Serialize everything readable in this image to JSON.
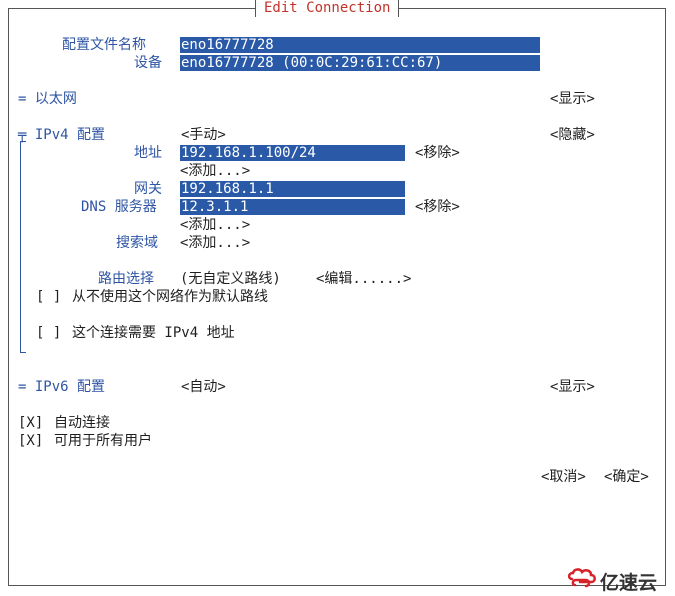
{
  "window": {
    "title": "Edit Connection"
  },
  "profile": {
    "name_label": "配置文件名称",
    "name_value": "eno16777728",
    "device_label": "设备",
    "device_value": "eno16777728 (00:0C:29:61:CC:67)"
  },
  "ethernet": {
    "label": "= 以太网",
    "toggle": "<显示>"
  },
  "ipv4": {
    "label": "╤ IPv4 配置",
    "method": "<手动>",
    "toggle": "<隐藏>",
    "address_label": "地址",
    "address_value": "192.168.1.100/24",
    "address_remove": "<移除>",
    "address_add": "<添加...>",
    "gateway_label": "网关",
    "gateway_value": "192.168.1.1",
    "dns_label": "DNS 服务器",
    "dns_value": "12.3.1.1",
    "dns_remove": "<移除>",
    "dns_add": "<添加...>",
    "search_label": "搜索域",
    "search_add": "<添加...>",
    "routing_label": "路由选择",
    "routing_value": "(无自定义路线)",
    "routing_edit": "<编辑......>",
    "never_default_check": "[ ]",
    "never_default_label": "从不使用这个网络作为默认路线",
    "require_ipv4_check": "[ ]",
    "require_ipv4_label": "这个连接需要 IPv4 地址"
  },
  "ipv6": {
    "label": "= IPv6 配置",
    "method": "<自动>",
    "toggle": "<显示>"
  },
  "options": {
    "autoconnect_check": "[X]",
    "autoconnect_label": "自动连接",
    "all_users_check": "[X]",
    "all_users_label": "可用于所有用户"
  },
  "buttons": {
    "cancel": "<取消>",
    "ok": "<确定>"
  },
  "watermark": {
    "text": "亿速云"
  }
}
